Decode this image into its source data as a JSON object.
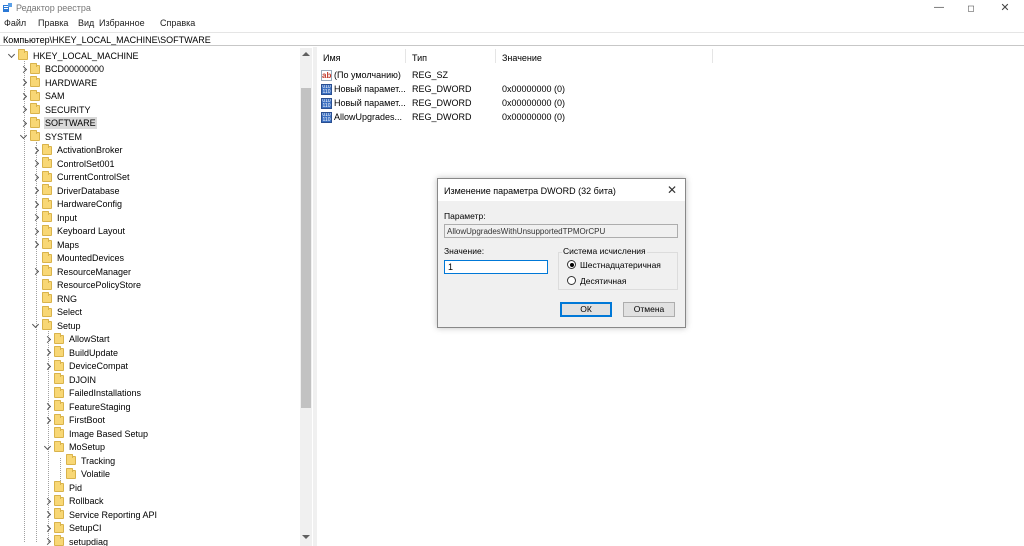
{
  "window": {
    "title": "Редактор реестра",
    "controls": {
      "minimize": "—",
      "maximize": "◻",
      "close": "✕"
    }
  },
  "menu": [
    "Файл",
    "Правка",
    "Вид",
    "Избранное",
    "Справка"
  ],
  "address": "Компьютер\\HKEY_LOCAL_MACHINE\\SOFTWARE",
  "tree": {
    "root": "HKEY_LOCAL_MACHINE",
    "level1": [
      "BCD00000000",
      "HARDWARE",
      "SAM",
      "SECURITY",
      "SOFTWARE",
      "SYSTEM"
    ],
    "system_children": [
      "ActivationBroker",
      "ControlSet001",
      "CurrentControlSet",
      "DriverDatabase",
      "HardwareConfig",
      "Input",
      "Keyboard Layout",
      "Maps",
      "MountedDevices",
      "ResourceManager",
      "ResourcePolicyStore",
      "RNG",
      "Select",
      "Setup"
    ],
    "setup_children": [
      "AllowStart",
      "BuildUpdate",
      "DeviceCompat",
      "DJOIN",
      "FailedInstallations",
      "FeatureStaging",
      "FirstBoot",
      "Image Based Setup",
      "MoSetup"
    ],
    "mosetup_children": [
      "Tracking",
      "Volatile"
    ],
    "setup_children_after": [
      "Pid",
      "Rollback",
      "Service Reporting API",
      "SetupCI",
      "setupdiag"
    ]
  },
  "list": {
    "headers": {
      "name": "Имя",
      "type": "Тип",
      "value": "Значение"
    },
    "rows": [
      {
        "icon": "string-value-icon",
        "name": "(По умолчанию)",
        "type": "REG_SZ",
        "value": ""
      },
      {
        "icon": "dword-value-icon",
        "name": "Новый парамет...",
        "type": "REG_DWORD",
        "value": "0x00000000 (0)"
      },
      {
        "icon": "dword-value-icon",
        "name": "Новый парамет...",
        "type": "REG_DWORD",
        "value": "0x00000000 (0)"
      },
      {
        "icon": "dword-value-icon",
        "name": "AllowUpgrades...",
        "type": "REG_DWORD",
        "value": "0x00000000 (0)"
      }
    ]
  },
  "dialog": {
    "title": "Изменение параметра DWORD (32 бита)",
    "close": "✕",
    "param_label": "Параметр:",
    "param_value": "AllowUpgradesWithUnsupportedTPMOrCPU",
    "value_label": "Значение:",
    "value": "1",
    "base_group": "Система исчисления",
    "base_hex": "Шестнадцатеричная",
    "base_dec": "Десятичная",
    "ok": "ОК",
    "cancel": "Отмена"
  }
}
